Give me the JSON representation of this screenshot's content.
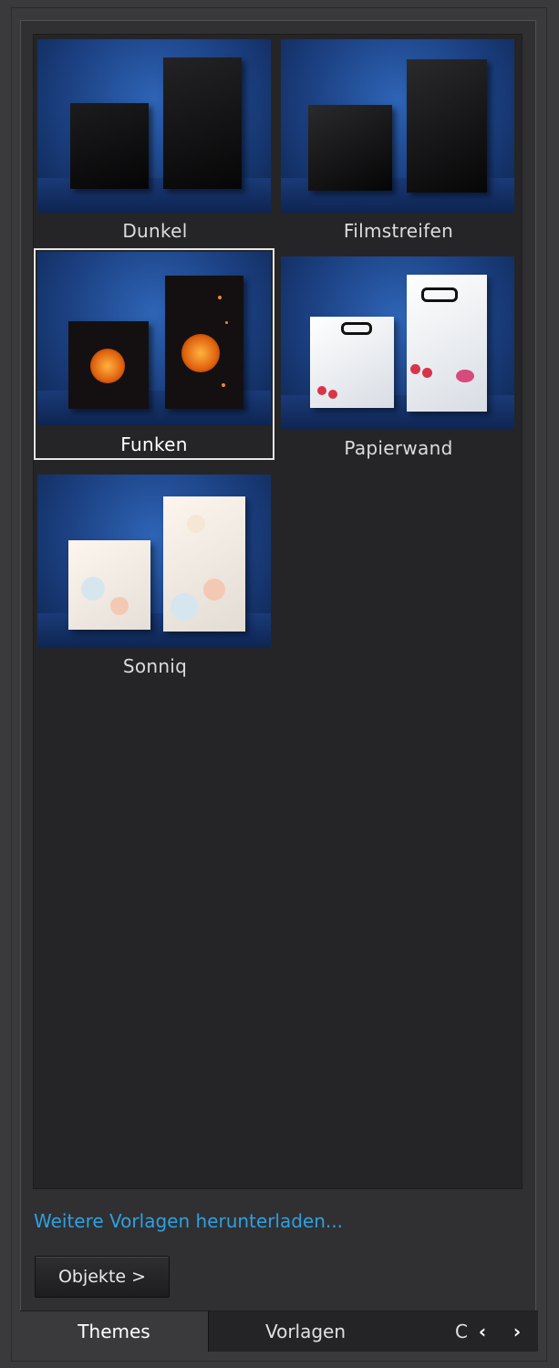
{
  "themes": [
    {
      "name": "Dunkel"
    },
    {
      "name": "Filmstreifen"
    },
    {
      "name": "Funken",
      "selected": true
    },
    {
      "name": "Papierwand"
    },
    {
      "name": "Sonniq"
    }
  ],
  "download_link": "Weitere Vorlagen herunterladen...",
  "objects_button": "Objekte >",
  "tabs": {
    "themes": "Themes",
    "vorlagen": "Vorlagen",
    "third": "C",
    "prev_icon": "‹",
    "next_icon": "›"
  },
  "colors": {
    "link": "#2fa0e0",
    "background": "#252527",
    "thumb_blue": "#1b3f80"
  }
}
